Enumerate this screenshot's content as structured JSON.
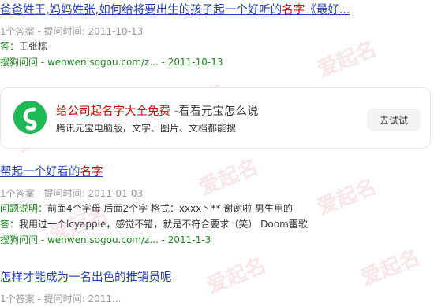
{
  "results": [
    {
      "title_a": "爸爸姓王,妈妈姓张,如何给将要出生的孩子起一个好听的",
      "title_hl": "名字",
      "title_b": "《最好...",
      "meta": "1个答案 - 提问时间: 2011-10-13",
      "answer_label": "答：",
      "answer_text": "王张栋",
      "source_name": "搜狗问问",
      "source_rest": " - wenwen.sogou.com/z... - 2011-10-13"
    },
    {
      "title_a": "帮起一个好看的",
      "title_hl": "名字",
      "title_b": "",
      "meta": "1个答案 - 提问时间: 2011-01-03",
      "question_label": "问题说明：",
      "question_text": "前面4个字母 后面2个字 格式：xxxx丶** 谢谢啦 男生用的",
      "answer_label": "答：",
      "answer_text": "我用过一个lcyapple，感觉不错，就是不符合要求（笑） Doom雷歌",
      "source_name": "搜狗问问",
      "source_rest": " - wenwen.sogou.com/z... - 2011-1-3"
    },
    {
      "title_a": "怎样才能成为一名出色的推销员呢",
      "title_hl": "",
      "title_b": "",
      "meta": "1个答案 - 提问时间: 2011..."
    }
  ],
  "ad": {
    "title_a": "给公司起",
    "title_hl": "名字大全免费",
    "title_b": " -看看元宝怎么说",
    "subtitle": "腾讯元宝电脑版，文字、图片、文档都能搜",
    "button_label": "去试试",
    "logo_icon": "yuanbao-logo-icon",
    "accent_color": "#1db954"
  },
  "watermark": "爱起名"
}
